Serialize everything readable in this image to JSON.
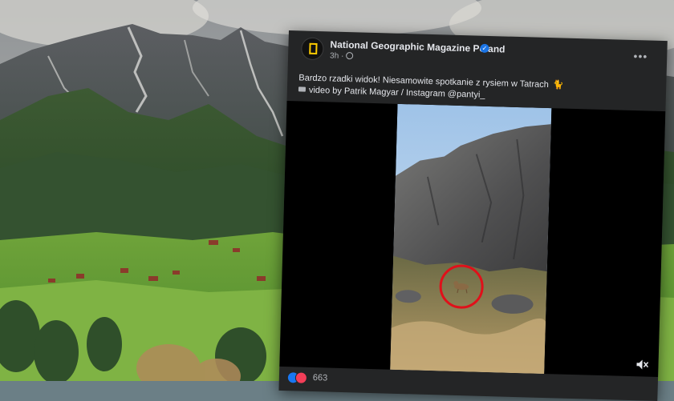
{
  "post": {
    "page_name": "National Geographic Magazine Poland",
    "time": "3h",
    "caption_line1": "Bardzo rzadki widok! Niesamowite spotkanie z rysiem w Tatrach",
    "caption_line2": "video by Patrik Magyar / Instagram @pantyi_",
    "reactions_count": "663",
    "icons": [
      "verified-badge-icon",
      "globe-icon",
      "more-options-icon",
      "camera-icon",
      "cat-emoji-icon",
      "like-reaction-icon",
      "love-reaction-icon",
      "mute-icon"
    ]
  },
  "colors": {
    "card_bg": "#242526",
    "text_primary": "#e4e6eb",
    "text_secondary": "#b0b3b8",
    "verified_blue": "#1b74e4",
    "highlight_circle": "#e0101a"
  }
}
